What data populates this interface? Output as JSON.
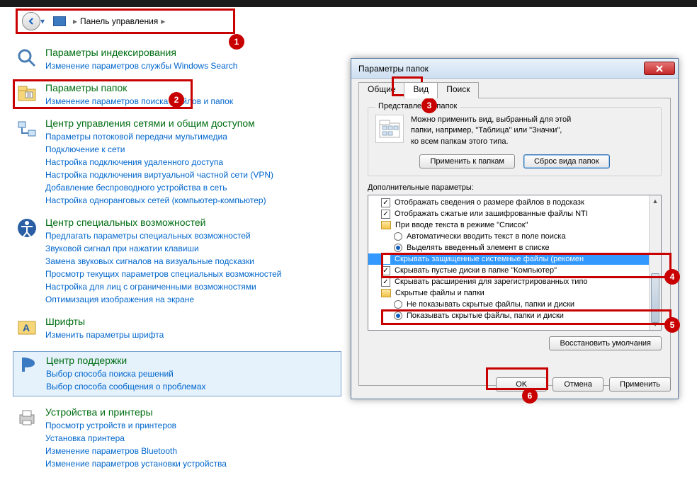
{
  "addressbar": {
    "text": "Панель управления"
  },
  "callouts": [
    "1",
    "2",
    "3",
    "4",
    "5",
    "6"
  ],
  "cp_sections": [
    {
      "title": "Параметры индексирования",
      "links": [
        "Изменение параметров службы Windows Search"
      ]
    },
    {
      "title": "Параметры папок",
      "links": [
        "Изменение параметров поиска файлов и папок"
      ]
    },
    {
      "title": "Центр управления сетями и общим доступом",
      "links": [
        "Параметры потоковой передачи мультимедиа",
        "Подключение к сети",
        "Настройка подключения удаленного доступа",
        "Настройка подключения виртуальной частной сети (VPN)",
        "Добавление беспроводного устройства в сеть",
        "Настройка одноранговых сетей (компьютер-компьютер)"
      ]
    },
    {
      "title": "Центр специальных возможностей",
      "links": [
        "Предлагать параметры специальных возможностей",
        "Звуковой сигнал при нажатии клавиши",
        "Замена звуковых сигналов на визуальные подсказки",
        "Просмотр текущих параметров специальных возможностей",
        "Настройка для лиц с ограниченными возможностями",
        "Оптимизация изображения на экране"
      ]
    },
    {
      "title": "Шрифты",
      "links": [
        "Изменить параметры шрифта"
      ]
    },
    {
      "title": "Центр поддержки",
      "links": [
        "Выбор способа поиска решений",
        "Выбор способа сообщения о проблемах"
      ]
    },
    {
      "title": "Устройства и принтеры",
      "links": [
        "Просмотр устройств и принтеров",
        "Установка принтера",
        "Изменение параметров Bluetooth",
        "Изменение параметров установки устройства"
      ]
    }
  ],
  "dialog": {
    "title": "Параметры папок",
    "tabs": {
      "general": "Общие",
      "view": "Вид",
      "search": "Поиск"
    },
    "group_title": "Представление папок",
    "group_text1": "Можно применить вид, выбранный для этой",
    "group_text2": "папки, например, \"Таблица\" или \"Значки\",",
    "group_text3": "ко всем папкам этого типа.",
    "btn_apply_folders": "Применить к папкам",
    "btn_reset_view": "Сброс вида папок",
    "adv_label": "Дополнительные параметры:",
    "rows": [
      {
        "kind": "chk",
        "checked": true,
        "text": "Отображать сведения о размере файлов в подсказк",
        "indent": 0
      },
      {
        "kind": "chk",
        "checked": true,
        "text": "Отображать сжатые или зашифрованные файлы NTI",
        "indent": 0
      },
      {
        "kind": "fld",
        "text": "При вводе текста в режиме \"Список\"",
        "indent": 0
      },
      {
        "kind": "rad",
        "checked": false,
        "text": "Автоматически вводить текст в поле поиска",
        "indent": 1
      },
      {
        "kind": "rad",
        "checked": true,
        "text": "Выделять введенный элемент в списке",
        "indent": 1
      },
      {
        "kind": "chk",
        "checked": false,
        "text": "Скрывать защищенные системные файлы (рекомен",
        "indent": 0,
        "selected": true
      },
      {
        "kind": "chk",
        "checked": true,
        "text": "Скрывать пустые диски в папке \"Компьютер\"",
        "indent": 0
      },
      {
        "kind": "chk",
        "checked": true,
        "text": "Скрывать расширения для зарегистрированных типо",
        "indent": 0
      },
      {
        "kind": "fld",
        "text": "Скрытые файлы и папки",
        "indent": 0
      },
      {
        "kind": "rad",
        "checked": false,
        "text": "Не показывать скрытые файлы, папки и диски",
        "indent": 1
      },
      {
        "kind": "rad",
        "checked": true,
        "text": "Показывать скрытые файлы, папки и диски",
        "indent": 1
      }
    ],
    "btn_restore": "Восстановить умолчания",
    "btn_ok": "OK",
    "btn_cancel": "Отмена",
    "btn_apply": "Применить"
  }
}
